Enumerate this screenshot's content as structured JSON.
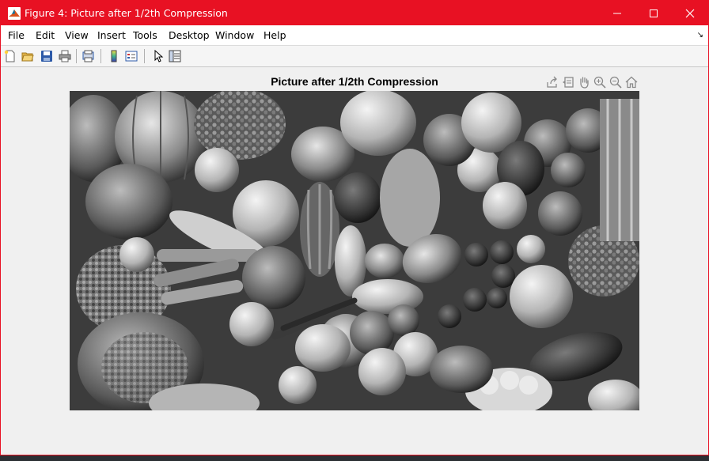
{
  "window": {
    "title": "Figure 4: Picture after 1/2th Compression",
    "accent_color": "#e81123",
    "controls": [
      "minimize-icon",
      "maximize-icon",
      "close-icon"
    ]
  },
  "menubar": {
    "items": [
      "File",
      "Edit",
      "View",
      "Insert",
      "Tools",
      "Desktop",
      "Window",
      "Help"
    ],
    "overflow_icon": "corner-arrow-icon"
  },
  "toolbar": {
    "buttons": [
      "new-figure-icon",
      "open-file-icon",
      "save-figure-icon",
      "print-figure-icon",
      "print-preview-icon",
      "insert-colorbar-icon",
      "insert-legend-icon",
      "edit-plot-icon",
      "property-inspector-icon"
    ]
  },
  "figure": {
    "axes_title": "Picture after 1/2th Compression",
    "axes_toolbar": [
      "export-icon",
      "data-tips-icon",
      "pan-icon",
      "zoom-in-icon",
      "zoom-out-icon",
      "restore-view-icon"
    ],
    "image": "grayscale photo of assorted vegetables and fruits"
  }
}
